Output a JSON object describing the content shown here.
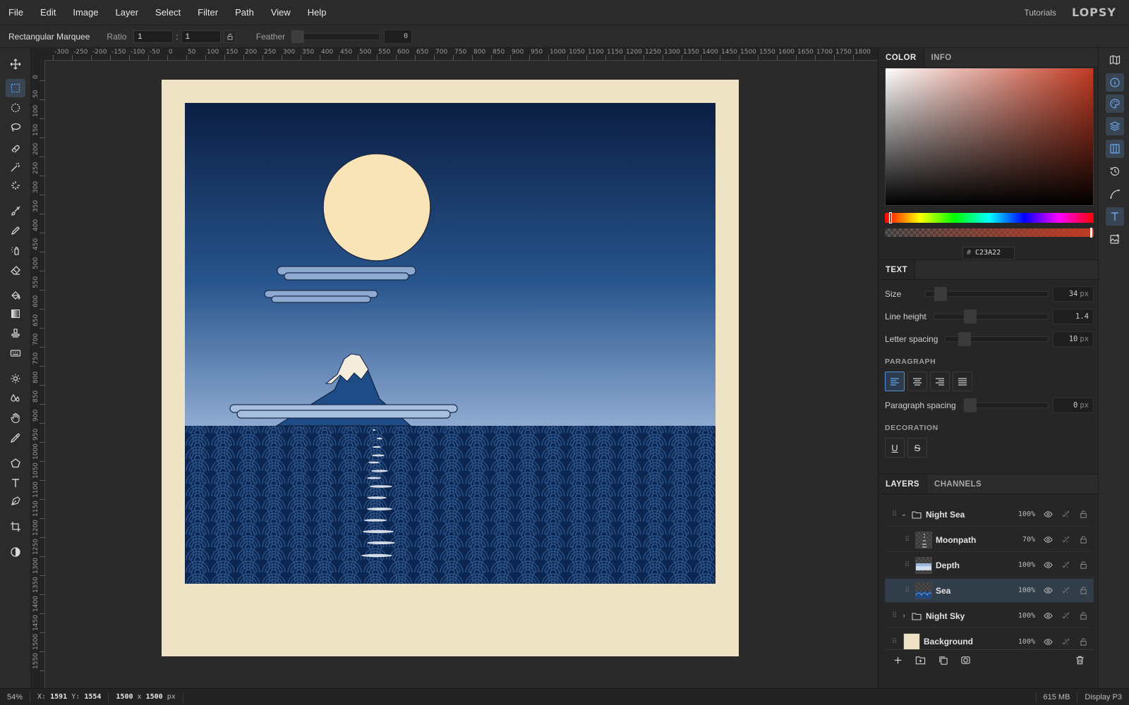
{
  "menu": [
    "File",
    "Edit",
    "Image",
    "Layer",
    "Select",
    "Filter",
    "Path",
    "View",
    "Help"
  ],
  "header": {
    "tutorials": "Tutorials",
    "logo": "LOPSY"
  },
  "options": {
    "tool_name": "Rectangular Marquee",
    "ratio_label": "Ratio",
    "ratio_w": "1",
    "ratio_sep": ":",
    "ratio_h": "1",
    "feather_label": "Feather",
    "feather_value": "0"
  },
  "ruler": {
    "top": [
      "-300",
      "-250",
      "-200",
      "-150",
      "-100",
      "-50",
      "0",
      "50",
      "100",
      "150",
      "200",
      "250",
      "300",
      "350",
      "400",
      "450",
      "500",
      "550",
      "600",
      "650",
      "700",
      "750",
      "800",
      "850",
      "900",
      "950",
      "1000",
      "1050",
      "1100",
      "1150",
      "1200",
      "1250",
      "1300",
      "1350",
      "1400",
      "1450",
      "1500",
      "1550",
      "1600",
      "1650",
      "1700",
      "1750",
      "1800"
    ],
    "left": [
      "0",
      "50",
      "100",
      "150",
      "200",
      "250",
      "300",
      "350",
      "400",
      "450",
      "500",
      "550",
      "600",
      "650",
      "700",
      "750",
      "800",
      "850",
      "900",
      "950",
      "1000",
      "1050",
      "1100",
      "1150",
      "1200",
      "1250",
      "1300",
      "1350",
      "1400",
      "1450",
      "1500",
      "1550"
    ]
  },
  "color": {
    "tab_color": "COLOR",
    "tab_info": "INFO",
    "hex": "C23A22",
    "hash": "#",
    "current": "#c23a22"
  },
  "text_panel": {
    "tab": "TEXT",
    "size_label": "Size",
    "size_value": "34",
    "size_unit": "px",
    "line_height_label": "Line height",
    "line_height_value": "1.4",
    "letter_spacing_label": "Letter spacing",
    "letter_spacing_value": "10",
    "letter_spacing_unit": "px",
    "paragraph_heading": "PARAGRAPH",
    "paragraph_spacing_label": "Paragraph spacing",
    "paragraph_spacing_value": "0",
    "paragraph_spacing_unit": "px",
    "decoration_heading": "DECORATION",
    "underline": "U",
    "strike": "S"
  },
  "layers": {
    "tab_layers": "LAYERS",
    "tab_channels": "CHANNELS",
    "items": [
      {
        "name": "Night Sea",
        "opacity": "100%"
      },
      {
        "name": "Moonpath",
        "opacity": "70%"
      },
      {
        "name": "Depth",
        "opacity": "100%"
      },
      {
        "name": "Sea",
        "opacity": "100%"
      },
      {
        "name": "Night Sky",
        "opacity": "100%"
      },
      {
        "name": "Background",
        "opacity": "100%"
      }
    ]
  },
  "status": {
    "zoom": "54%",
    "x_label": "X:",
    "x": "1591",
    "y_label": "Y:",
    "y": "1554",
    "dim_w": "1500",
    "dim_x": "x",
    "dim_h": "1500",
    "dim_unit": "px",
    "memory": "615 MB",
    "profile": "Display P3"
  }
}
